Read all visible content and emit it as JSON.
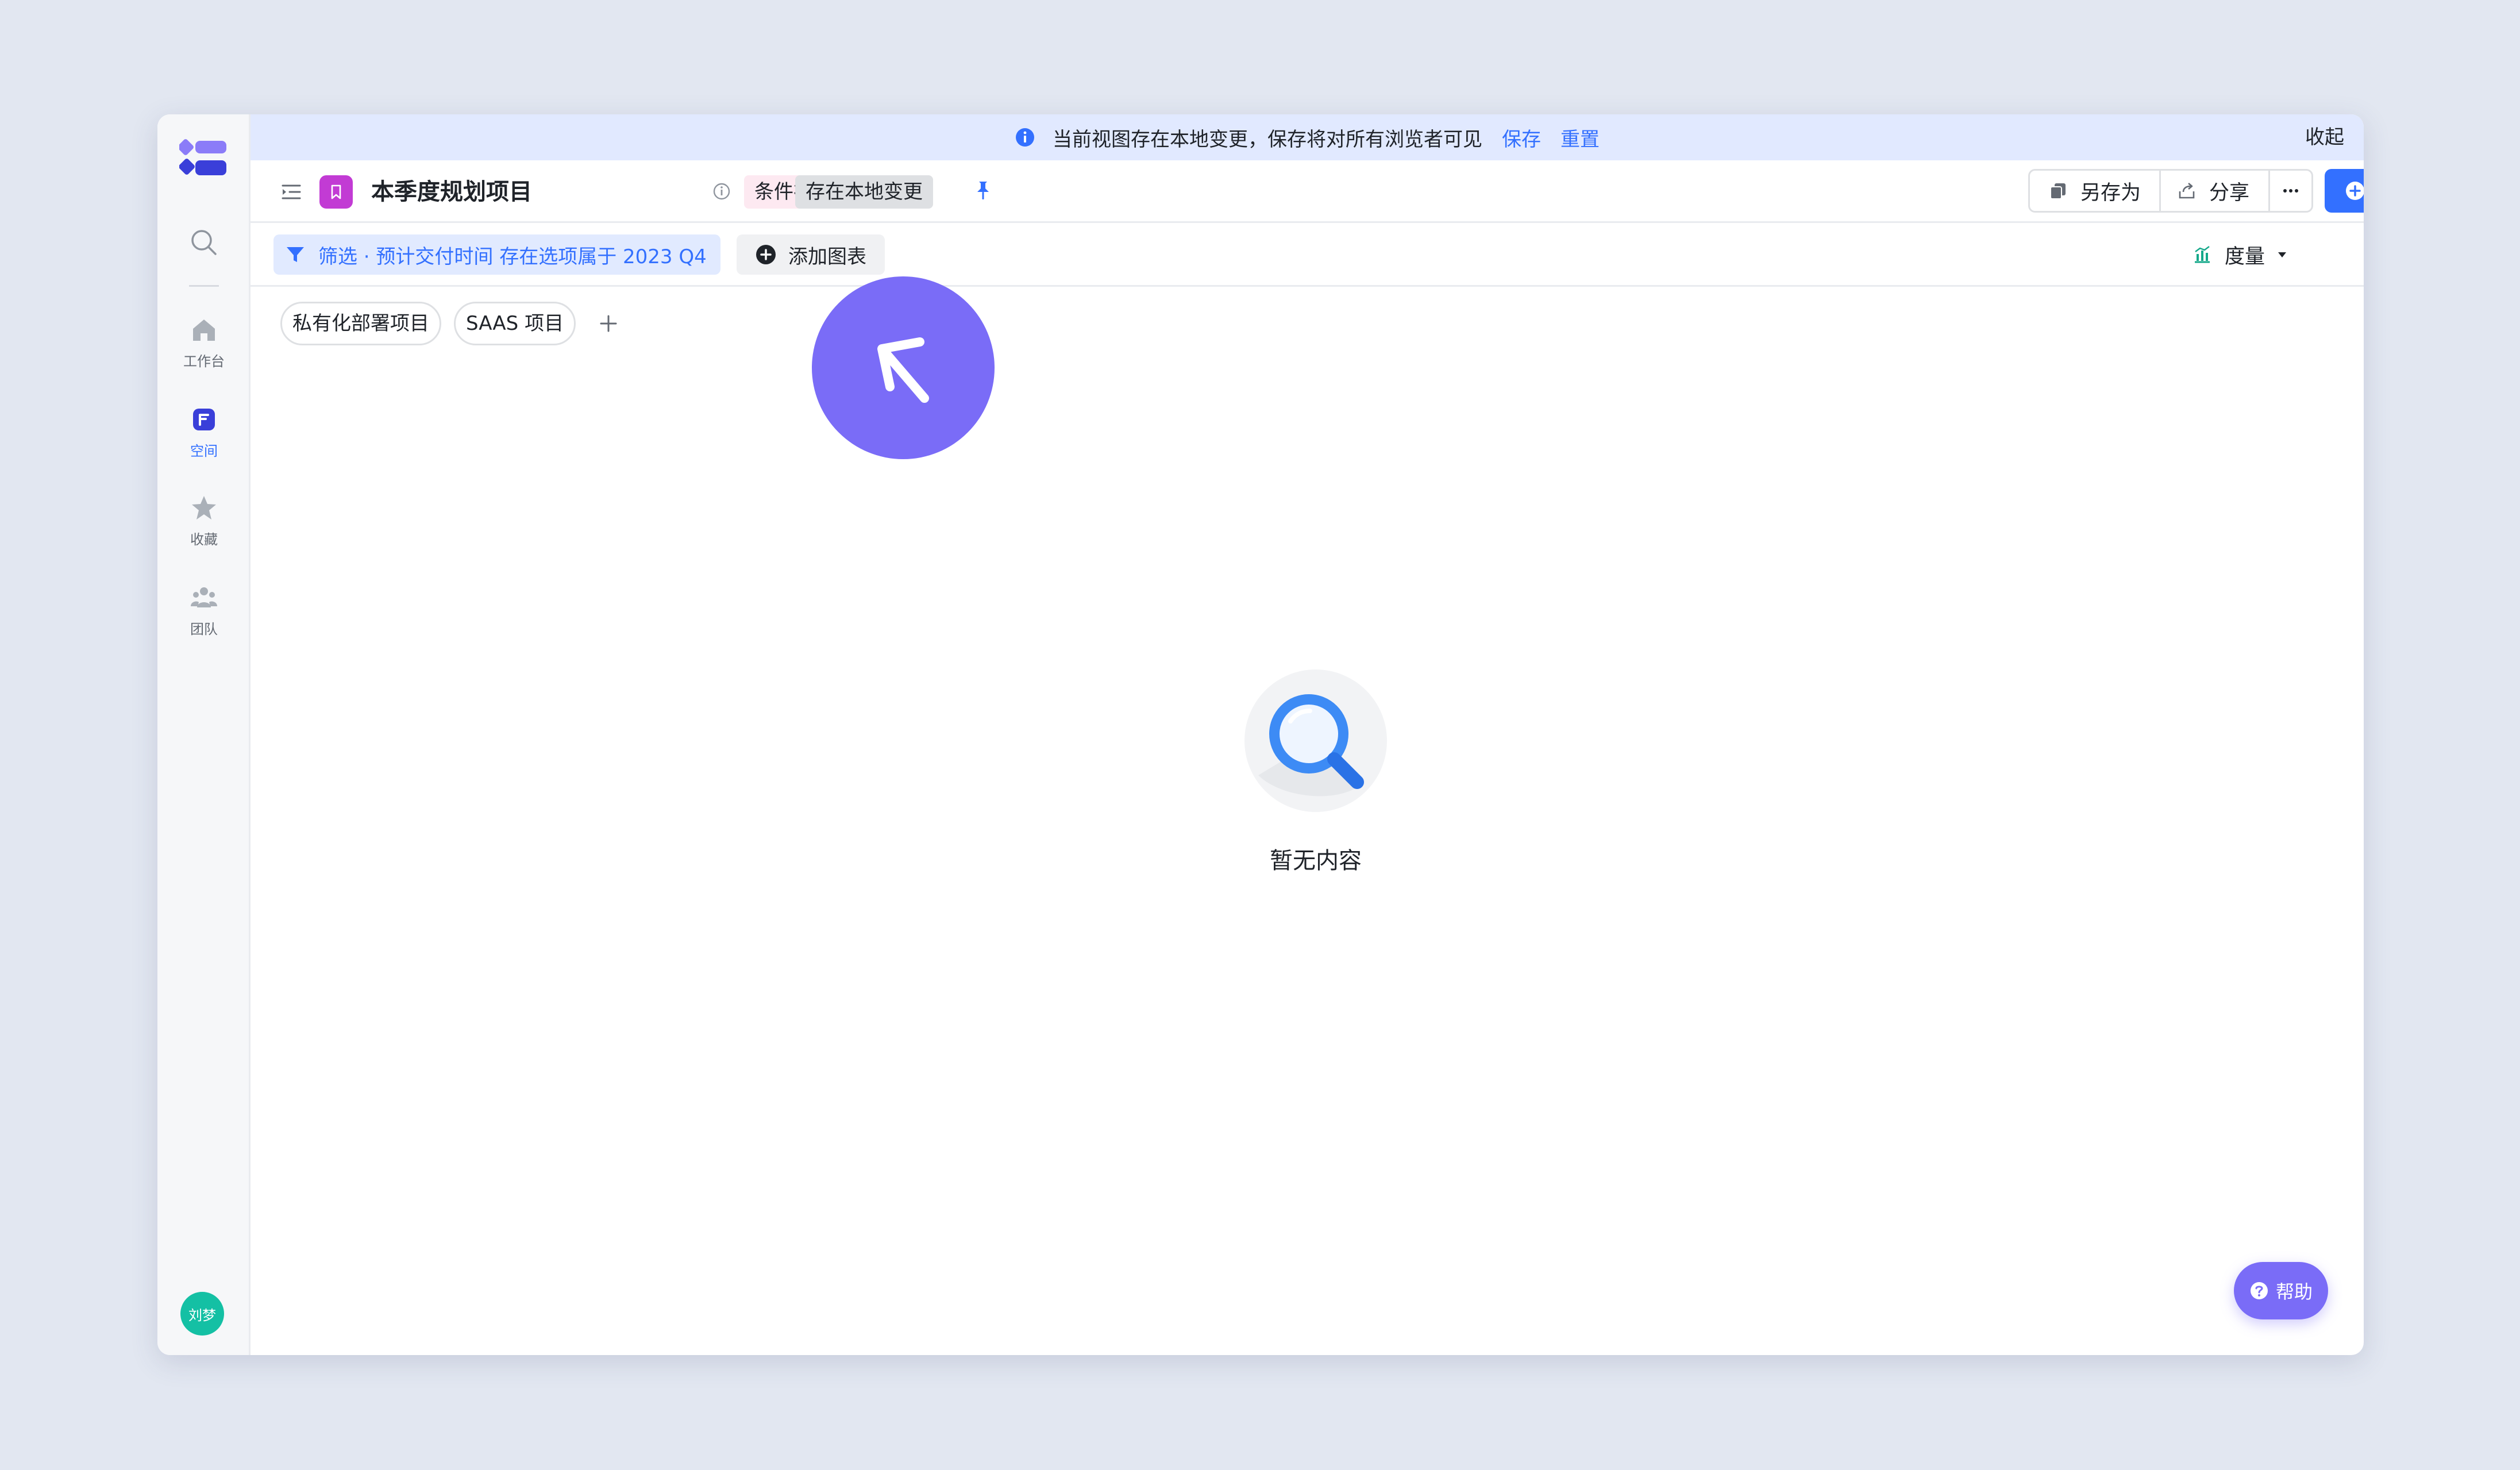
{
  "rail": {
    "items": [
      {
        "label": "工作台",
        "icon": "home-icon"
      },
      {
        "label": "空间",
        "icon": "space-icon",
        "active": true
      },
      {
        "label": "收藏",
        "icon": "star-icon"
      },
      {
        "label": "团队",
        "icon": "team-icon"
      }
    ],
    "avatar": "刘梦"
  },
  "notice": {
    "message": "当前视图存在本地变更，保存将对所有浏览者可见",
    "save": "保存",
    "reset": "重置",
    "collapse": "收起"
  },
  "header": {
    "title": "本季度规划项目",
    "tag_condition": "条件视图",
    "tag_local": "存在本地变更",
    "save_as": "另存为",
    "share": "分享",
    "new": "新建"
  },
  "toolbar": {
    "filter": "筛选 · 预计交付时间 存在选项属于 2023 Q4",
    "add_chart": "添加图表",
    "metric": "度量"
  },
  "groups": [
    "私有化部署项目",
    "SAAS 项目"
  ],
  "empty": {
    "text": "暂无内容"
  },
  "help": "帮助",
  "colors": {
    "accent": "#3370ff",
    "notice_bg": "#e1e9ff",
    "cursor_bubble": "#7a6cf7",
    "view_icon": "#c23bd4",
    "avatar": "#14c0a4"
  }
}
